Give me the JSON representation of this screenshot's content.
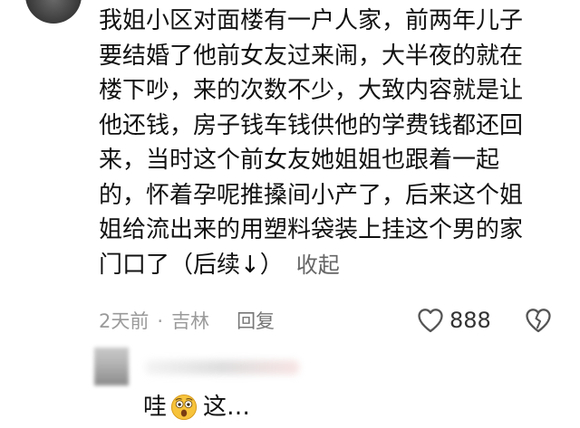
{
  "comment": {
    "lines": [
      "我姐小区对面楼有一户人家，前两年儿子",
      "要结婚了他前女友过来闹，大半夜的就在",
      "楼下吵，来的次数不少，大致内容就是让",
      "他还钱，房子钱车钱供他的学费钱都还回",
      "来，当时这个前女友她姐姐也跟着一起",
      "的，怀着孕呢推搡间小产了，后来这个姐",
      "姐给流出来的用塑料袋装上挂这个男的家",
      "门口了（后续↓）"
    ],
    "collapse_label": "收起",
    "time": "2天前",
    "separator": "·",
    "location": "吉林",
    "reply_label": "回复",
    "like_count": "888",
    "like_icon": "heart-outline-icon",
    "dislike_icon": "broken-heart-icon"
  },
  "reply": {
    "prefix": "哇",
    "emoji": "astonished-face-emoji",
    "suffix": "这…"
  },
  "colors": {
    "text": "#111111",
    "meta": "#9a9a9a",
    "emoji_yellow": "#f7c33b"
  }
}
